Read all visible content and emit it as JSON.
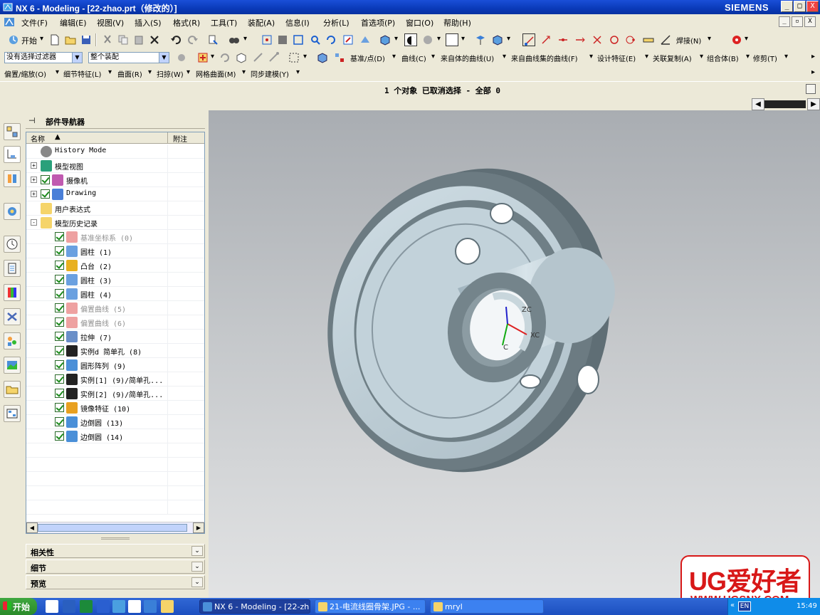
{
  "window": {
    "title": "NX 6 - Modeling - [22-zhao.prt（修改的）]",
    "brand": "SIEMENS",
    "btn_min": "_",
    "btn_max": "□",
    "btn_close": "X"
  },
  "menubar": {
    "items": [
      "文件(F)",
      "编辑(E)",
      "视图(V)",
      "插入(S)",
      "格式(R)",
      "工具(T)",
      "装配(A)",
      "信息(I)",
      "分析(L)",
      "首选项(P)",
      "窗口(O)",
      "帮助(H)"
    ],
    "mdi_min": "_",
    "mdi_restore": "▫",
    "mdi_close": "X"
  },
  "toolbar1": {
    "start_label": "开始",
    "weld_label": "焊接(N)"
  },
  "toolbar2": {
    "filter_value": "没有选择过滤器",
    "scope_value": "整个装配",
    "menus": [
      "基准/点(D)",
      "曲线(C)",
      "来自体的曲线(U)",
      "来自曲线集的曲线(F)",
      "设计特征(E)",
      "关联复制(A)",
      "组合体(B)",
      "修剪(T)"
    ]
  },
  "toolbar3": {
    "menus": [
      "偏置/缩放(O)",
      "细节特征(L)",
      "曲面(R)",
      "扫掠(W)",
      "网格曲面(M)",
      "同步建模(Y)"
    ]
  },
  "status": {
    "text": "1 个对象 已取消选择 - 全部 0"
  },
  "navigator": {
    "title": "部件导航器",
    "col_name": "名称",
    "col_note": "附注",
    "tree": [
      {
        "label": "History Mode",
        "icon": "clock-icon",
        "level": 0,
        "expander": "",
        "checked": false,
        "dim": false
      },
      {
        "label": "模型视图",
        "icon": "model-views-icon",
        "level": 0,
        "expander": "+",
        "checked": false,
        "dim": false
      },
      {
        "label": "摄像机",
        "icon": "camera-icon",
        "level": 0,
        "expander": "+",
        "checked": true,
        "dim": false
      },
      {
        "label": "Drawing",
        "icon": "drawing-icon",
        "level": 0,
        "expander": "+",
        "checked": true,
        "dim": false
      },
      {
        "label": "用户表达式",
        "icon": "folder-icon",
        "level": 0,
        "expander": "",
        "checked": false,
        "dim": false
      },
      {
        "label": "模型历史记录",
        "icon": "folder-open-icon",
        "level": 0,
        "expander": "-",
        "checked": false,
        "dim": false
      },
      {
        "label": "基准坐标系 (0)",
        "icon": "datum-csys-icon",
        "level": 1,
        "expander": "",
        "checked": true,
        "dim": true
      },
      {
        "label": "圆柱 (1)",
        "icon": "cylinder-icon",
        "level": 1,
        "expander": "",
        "checked": true,
        "dim": false
      },
      {
        "label": "凸台 (2)",
        "icon": "boss-icon",
        "level": 1,
        "expander": "",
        "checked": true,
        "dim": false
      },
      {
        "label": "圆柱 (3)",
        "icon": "cylinder-icon",
        "level": 1,
        "expander": "",
        "checked": true,
        "dim": false
      },
      {
        "label": "圆柱 (4)",
        "icon": "cylinder-icon",
        "level": 1,
        "expander": "",
        "checked": true,
        "dim": false
      },
      {
        "label": "偏置曲线 (5)",
        "icon": "offset-curve-icon",
        "level": 1,
        "expander": "",
        "checked": true,
        "dim": true
      },
      {
        "label": "偏置曲线 (6)",
        "icon": "offset-curve-icon",
        "level": 1,
        "expander": "",
        "checked": true,
        "dim": true
      },
      {
        "label": "拉伸 (7)",
        "icon": "extrude-icon",
        "level": 1,
        "expander": "",
        "checked": true,
        "dim": false
      },
      {
        "label": "实例d 简单孔 (8)",
        "icon": "hole-icon",
        "level": 1,
        "expander": "",
        "checked": true,
        "dim": false
      },
      {
        "label": "圆形阵列 (9)",
        "icon": "circular-array-icon",
        "level": 1,
        "expander": "",
        "checked": true,
        "dim": false
      },
      {
        "label": "实例[1] (9)/简单孔...",
        "icon": "hole-icon",
        "level": 1,
        "expander": "",
        "checked": true,
        "dim": false
      },
      {
        "label": "实例[2] (9)/简单孔...",
        "icon": "hole-icon",
        "level": 1,
        "expander": "",
        "checked": true,
        "dim": false
      },
      {
        "label": "镜像特征 (10)",
        "icon": "mirror-feature-icon",
        "level": 1,
        "expander": "",
        "checked": true,
        "dim": false
      },
      {
        "label": "边倒圆 (13)",
        "icon": "edge-blend-icon",
        "level": 1,
        "expander": "",
        "checked": true,
        "dim": false
      },
      {
        "label": "边倒圆 (14)",
        "icon": "edge-blend-icon",
        "level": 1,
        "expander": "",
        "checked": true,
        "dim": false
      }
    ],
    "panels": [
      "相关性",
      "细节",
      "预览"
    ]
  },
  "viewport": {
    "axis_z": "ZC",
    "axis_x": "XC",
    "axis_y": "C"
  },
  "watermark": {
    "title": "UG爱好者",
    "url": "WWW.UGSNX.COM"
  },
  "taskbar": {
    "start": "开始",
    "tasks": [
      "NX 6 - Modeling - [22-zh...",
      "21-电流线圈骨架.JPG - ...",
      "mryl"
    ],
    "lang": "EN",
    "clock": "15:49"
  }
}
